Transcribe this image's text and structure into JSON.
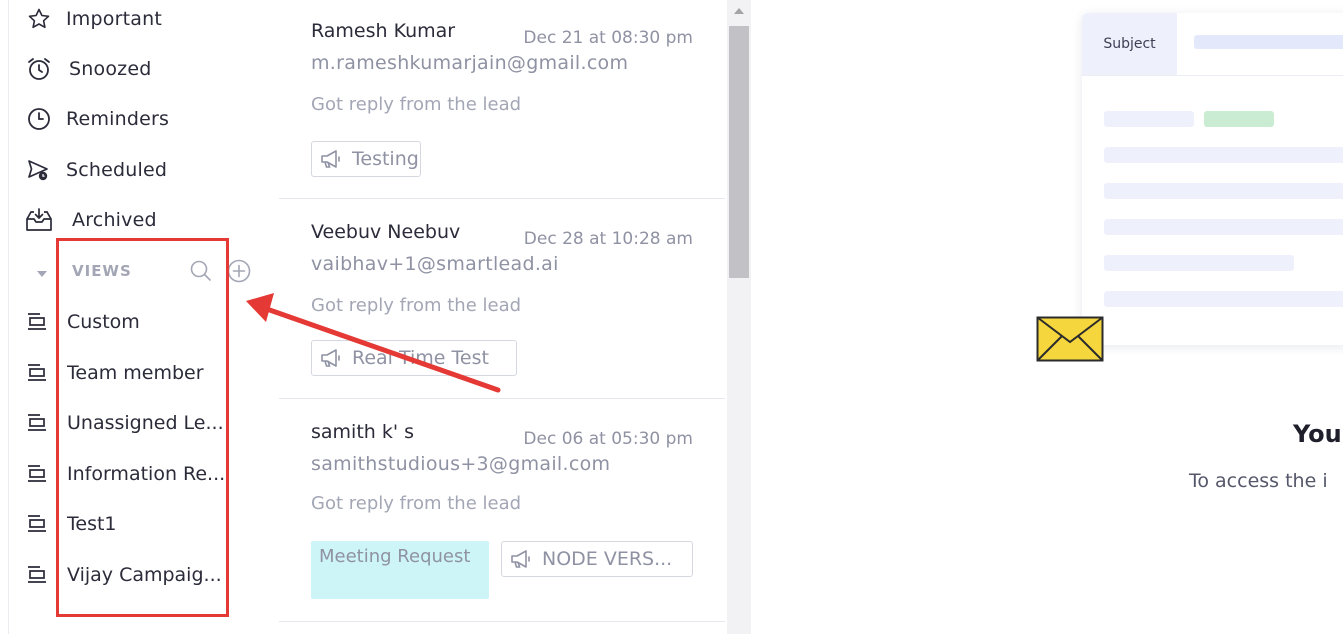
{
  "sidebar": {
    "nav": [
      {
        "label": "Important",
        "icon": "star-icon"
      },
      {
        "label": "Snoozed",
        "icon": "alarm-clock-icon"
      },
      {
        "label": "Reminders",
        "icon": "clock-icon"
      },
      {
        "label": "Scheduled",
        "icon": "scheduled-send-icon"
      },
      {
        "label": "Archived",
        "icon": "archive-inbox-icon"
      }
    ],
    "views_label": "VIEWS",
    "views": [
      {
        "label": "Custom"
      },
      {
        "label": "Team member"
      },
      {
        "label": "Unassigned Le..."
      },
      {
        "label": "Information Re..."
      },
      {
        "label": "Test1"
      },
      {
        "label": "Vijay Campaig..."
      }
    ]
  },
  "threads": [
    {
      "name": "Ramesh Kumar",
      "date": "Dec 21 at 08:30 pm",
      "email": "m.rameshkumarjain@gmail.com",
      "snippet": "Got reply from the lead",
      "tags": [
        "Testing"
      ]
    },
    {
      "name": "Veebuv Neebuv",
      "date": "Dec 28 at 10:28 am",
      "email": "vaibhav+1@smartlead.ai",
      "snippet": "Got reply from the lead",
      "tags": [
        "Real Time Test"
      ]
    },
    {
      "name": "samith k' s",
      "date": "Dec 06 at 05:30 pm",
      "email": "samithstudious+3@gmail.com",
      "snippet": "Got reply from the lead",
      "category": "Meeting Request",
      "tags": [
        "NODE VERS..."
      ]
    }
  ],
  "empty_state": {
    "preview_subject": "Subject",
    "title": "You",
    "subtitle": "To access the i"
  },
  "colors": {
    "highlight": "#e53935",
    "meeting_tag_bg": "#cdf4f7",
    "envelope": "#f5d63d"
  }
}
